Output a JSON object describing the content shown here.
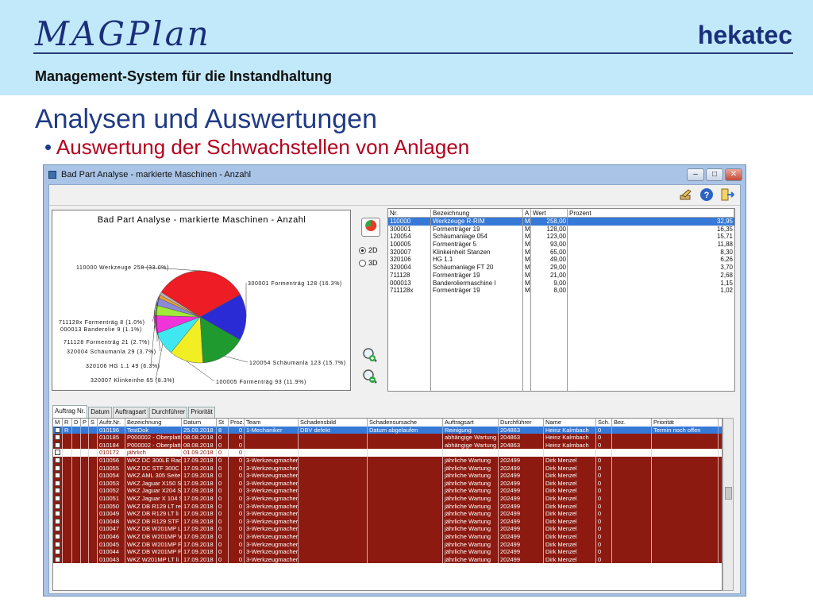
{
  "slide": {
    "logo": "MAGPlan",
    "brand": "hekatec",
    "subtitle": "Management-System für die Instandhaltung",
    "heading": "Analysen und Auswertungen",
    "bullet_marker": "•",
    "bullet": "Auswertung der Schwachstellen von Anlagen"
  },
  "window": {
    "title": "Bad Part Analyse - markierte Maschinen - Anzahl",
    "minimize": "–",
    "maximize": "□",
    "close": "✕"
  },
  "toolbar": {
    "icons": [
      "edit-icon",
      "help-icon",
      "exit-icon"
    ],
    "help_label": "?"
  },
  "controls": {
    "radio_2d": "2D",
    "radio_3d": "3D",
    "selected": "2D"
  },
  "chart_data": {
    "type": "pie",
    "title": "Bad Part Analyse - markierte Maschinen - Anzahl",
    "slices": [
      {
        "label": "110000 Werkzeuge 258 (33.0%)",
        "value": 258,
        "color": "#ee1c25"
      },
      {
        "label": "300001 Formenträg 128 (16.3%)",
        "value": 128,
        "color": "#2b2bd6"
      },
      {
        "label": "120054 Schäumanla 123 (15.7%)",
        "value": 123,
        "color": "#1e9a2e"
      },
      {
        "label": "100005 Formenträg 93 (11.9%)",
        "value": 93,
        "color": "#f2ee24"
      },
      {
        "label": "320007 Klinkeinhe 65 (8.3%)",
        "value": 65,
        "color": "#3fe8f0"
      },
      {
        "label": "320106 HG 1.1 49 (6.3%)",
        "value": 49,
        "color": "#ef34d9"
      },
      {
        "label": "320004 Schäumanla 29 (3.7%)",
        "value": 29,
        "color": "#a1ea38"
      },
      {
        "label": "711128 Formenträg 21 (2.7%)",
        "value": 21,
        "color": "#8a8ad8"
      },
      {
        "label": "000013 Banderolie 9 (1.1%)",
        "value": 9,
        "color": "#f0a030"
      },
      {
        "label": "711128x Formenträg 8 (1.0%)",
        "value": 8,
        "color": "#b8b8b8"
      }
    ]
  },
  "right_table": {
    "columns": [
      "Nr.",
      "Bezeichnung",
      "A",
      "Wert",
      "Prozent"
    ],
    "rows": [
      {
        "nr": "110000",
        "bez": "Werkzeuge R-RIM",
        "a": "M",
        "wert": "258,00",
        "proz": "32,95",
        "selected": true
      },
      {
        "nr": "300001",
        "bez": "Formenträger 19",
        "a": "M",
        "wert": "128,00",
        "proz": "16,35"
      },
      {
        "nr": "120054",
        "bez": "Schäumanlage 054",
        "a": "M",
        "wert": "123,00",
        "proz": "15,71"
      },
      {
        "nr": "100005",
        "bez": "Formenträger 5",
        "a": "M",
        "wert": "93,00",
        "proz": "11,88"
      },
      {
        "nr": "320007",
        "bez": "Klinkeinheit Stanzen",
        "a": "M",
        "wert": "65,00",
        "proz": "8,30"
      },
      {
        "nr": "320106",
        "bez": "HG 1.1",
        "a": "M",
        "wert": "49,00",
        "proz": "6,26"
      },
      {
        "nr": "320004",
        "bez": "Schäumanlage FT 20",
        "a": "M",
        "wert": "29,00",
        "proz": "3,70"
      },
      {
        "nr": "711128",
        "bez": "Formenträger 19",
        "a": "M",
        "wert": "21,00",
        "proz": "2,68"
      },
      {
        "nr": "000013",
        "bez": "Banderoliermaschine I",
        "a": "M",
        "wert": "9,00",
        "proz": "1,15"
      },
      {
        "nr": "711128x",
        "bez": "Formenträger 19",
        "a": "M",
        "wert": "8,00",
        "proz": "1,02"
      }
    ]
  },
  "tabs": [
    "Auftrag Nr.",
    "Datum",
    "Auftragsart",
    "Durchführer",
    "Priorität"
  ],
  "bottom_table": {
    "columns": [
      "M",
      "R",
      "D",
      "P",
      "S",
      "Auftr.Nr.",
      "Bezeichnung",
      "Datum",
      "St",
      "Proz.",
      "Team",
      "Schadensbild",
      "Schadensursache",
      "Auftragsart",
      "Durchführer",
      "Name",
      "Sch.",
      "Bez.",
      "Priorität"
    ],
    "rows": [
      {
        "style": "sel",
        "r": "R",
        "nr": "010196",
        "bez": "TestDok",
        "datum": "25.09.2018",
        "st": "8",
        "proz": "0",
        "team": "1-Mechaniker",
        "bild": "DBV defekt",
        "ursache": "Datum abgelaufen",
        "art": "Reinigung",
        "durch": "204863",
        "name": "Heinz Kalmbach",
        "sch": "0",
        "prio": "Termin noch offen"
      },
      {
        "style": "red",
        "r": "",
        "nr": "010185",
        "bez": "P000002 - Oberplatte",
        "datum": "08.08.2018",
        "st": "0",
        "proz": "0",
        "team": "",
        "bild": "",
        "ursache": "",
        "art": "abhängige Wartung",
        "durch": "204863",
        "name": "Heinz Kalmbach",
        "sch": "0",
        "prio": ""
      },
      {
        "style": "red",
        "r": "",
        "nr": "010184",
        "bez": "P000002 - Oberplatte",
        "datum": "08.08.2018",
        "st": "0",
        "proz": "0",
        "team": "",
        "bild": "",
        "ursache": "",
        "art": "abhängige Wartung",
        "durch": "204863",
        "name": "Heinz Kalmbach",
        "sch": "0",
        "prio": ""
      },
      {
        "style": "white",
        "r": "",
        "nr": "010172",
        "bez": "jährlich",
        "datum": "01.09.2018",
        "st": "0",
        "proz": "0",
        "team": "",
        "bild": "",
        "ursache": "",
        "art": "",
        "durch": "",
        "name": "",
        "sch": "",
        "prio": ""
      },
      {
        "style": "red",
        "r": "",
        "nr": "010056",
        "bez": "WKZ DC 300LE Radla",
        "datum": "17.09.2018",
        "st": "0",
        "proz": "0",
        "team": "3-Werkzeugmacher",
        "bild": "",
        "ursache": "",
        "art": "jährliche Wartung",
        "durch": "202499",
        "name": "Dirk Menzel",
        "sch": "0",
        "prio": ""
      },
      {
        "style": "red",
        "r": "",
        "nr": "010055",
        "bez": "WKZ DC STF 300C",
        "datum": "17.09.2018",
        "st": "0",
        "proz": "0",
        "team": "3-Werkzeugmacher",
        "bild": "",
        "ursache": "",
        "art": "jährliche Wartung",
        "durch": "202499",
        "name": "Dirk Menzel",
        "sch": "0",
        "prio": ""
      },
      {
        "style": "red",
        "r": "",
        "nr": "010054",
        "bez": "WKZ AML 305 Seite",
        "datum": "17.09.2018",
        "st": "0",
        "proz": "0",
        "team": "3-Werkzeugmacher",
        "bild": "",
        "ursache": "",
        "art": "jährliche Wartung",
        "durch": "202499",
        "name": "Dirk Menzel",
        "sch": "0",
        "prio": ""
      },
      {
        "style": "red",
        "r": "",
        "nr": "010053",
        "bez": "WKZ Jaguar X150 S",
        "datum": "17.09.2018",
        "st": "0",
        "proz": "0",
        "team": "3-Werkzeugmacher",
        "bild": "",
        "ursache": "",
        "art": "jährliche Wartung",
        "durch": "202499",
        "name": "Dirk Menzel",
        "sch": "0",
        "prio": ""
      },
      {
        "style": "red",
        "r": "",
        "nr": "010052",
        "bez": "WKZ Jaguar X204 S",
        "datum": "17.09.2018",
        "st": "0",
        "proz": "0",
        "team": "3-Werkzeugmacher",
        "bild": "",
        "ursache": "",
        "art": "jährliche Wartung",
        "durch": "202499",
        "name": "Dirk Menzel",
        "sch": "0",
        "prio": ""
      },
      {
        "style": "red",
        "r": "",
        "nr": "010051",
        "bez": "WKZ Jaguar X 104 S",
        "datum": "17.09.2018",
        "st": "0",
        "proz": "0",
        "team": "3-Werkzeugmacher",
        "bild": "",
        "ursache": "",
        "art": "jährliche Wartung",
        "durch": "202499",
        "name": "Dirk Menzel",
        "sch": "0",
        "prio": ""
      },
      {
        "style": "red",
        "r": "",
        "nr": "010050",
        "bez": "WKZ DB R129 LT re",
        "datum": "17.09.2018",
        "st": "0",
        "proz": "0",
        "team": "3-Werkzeugmacher",
        "bild": "",
        "ursache": "",
        "art": "jährliche Wartung",
        "durch": "202499",
        "name": "Dirk Menzel",
        "sch": "0",
        "prio": ""
      },
      {
        "style": "red",
        "r": "",
        "nr": "010049",
        "bez": "WKZ DB R129 LT li",
        "datum": "17.09.2018",
        "st": "0",
        "proz": "0",
        "team": "3-Werkzeugmacher",
        "bild": "",
        "ursache": "",
        "art": "jährliche Wartung",
        "durch": "202499",
        "name": "Dirk Menzel",
        "sch": "0",
        "prio": ""
      },
      {
        "style": "red",
        "r": "",
        "nr": "010048",
        "bez": "WKZ DB R129 STF",
        "datum": "17.09.2018",
        "st": "0",
        "proz": "0",
        "team": "3-Werkzeugmacher",
        "bild": "",
        "ursache": "",
        "art": "jährliche Wartung",
        "durch": "202499",
        "name": "Dirk Menzel",
        "sch": "0",
        "prio": ""
      },
      {
        "style": "red",
        "r": "",
        "nr": "010047",
        "bez": "WKZ DB W201MP LI",
        "datum": "17.09.2018",
        "st": "0",
        "proz": "0",
        "team": "3-Werkzeugmacher",
        "bild": "",
        "ursache": "",
        "art": "jährliche Wartung",
        "durch": "202499",
        "name": "Dirk Menzel",
        "sch": "0",
        "prio": ""
      },
      {
        "style": "red",
        "r": "",
        "nr": "010046",
        "bez": "WKZ DB W201MP V",
        "datum": "17.09.2018",
        "st": "0",
        "proz": "0",
        "team": "3-Werkzeugmacher",
        "bild": "",
        "ursache": "",
        "art": "jährliche Wartung",
        "durch": "202499",
        "name": "Dirk Menzel",
        "sch": "0",
        "prio": ""
      },
      {
        "style": "red",
        "r": "",
        "nr": "010045",
        "bez": "WKZ DB W201MP FL",
        "datum": "17.09.2018",
        "st": "0",
        "proz": "0",
        "team": "3-Werkzeugmacher",
        "bild": "",
        "ursache": "",
        "art": "jährliche Wartung",
        "durch": "202499",
        "name": "Dirk Menzel",
        "sch": "0",
        "prio": ""
      },
      {
        "style": "red",
        "r": "",
        "nr": "010044",
        "bez": "WKZ DB W201MP F",
        "datum": "17.09.2018",
        "st": "0",
        "proz": "0",
        "team": "3-Werkzeugmacher",
        "bild": "",
        "ursache": "",
        "art": "jährliche Wartung",
        "durch": "202499",
        "name": "Dirk Menzel",
        "sch": "0",
        "prio": ""
      },
      {
        "style": "red",
        "r": "",
        "nr": "010043",
        "bez": "WKZ W201MP LT li",
        "datum": "17.09.2018",
        "st": "0",
        "proz": "0",
        "team": "3-Werkzeugmacher",
        "bild": "",
        "ursache": "",
        "art": "jährliche Wartung",
        "durch": "202499",
        "name": "Dirk Menzel",
        "sch": "0",
        "prio": ""
      }
    ]
  }
}
